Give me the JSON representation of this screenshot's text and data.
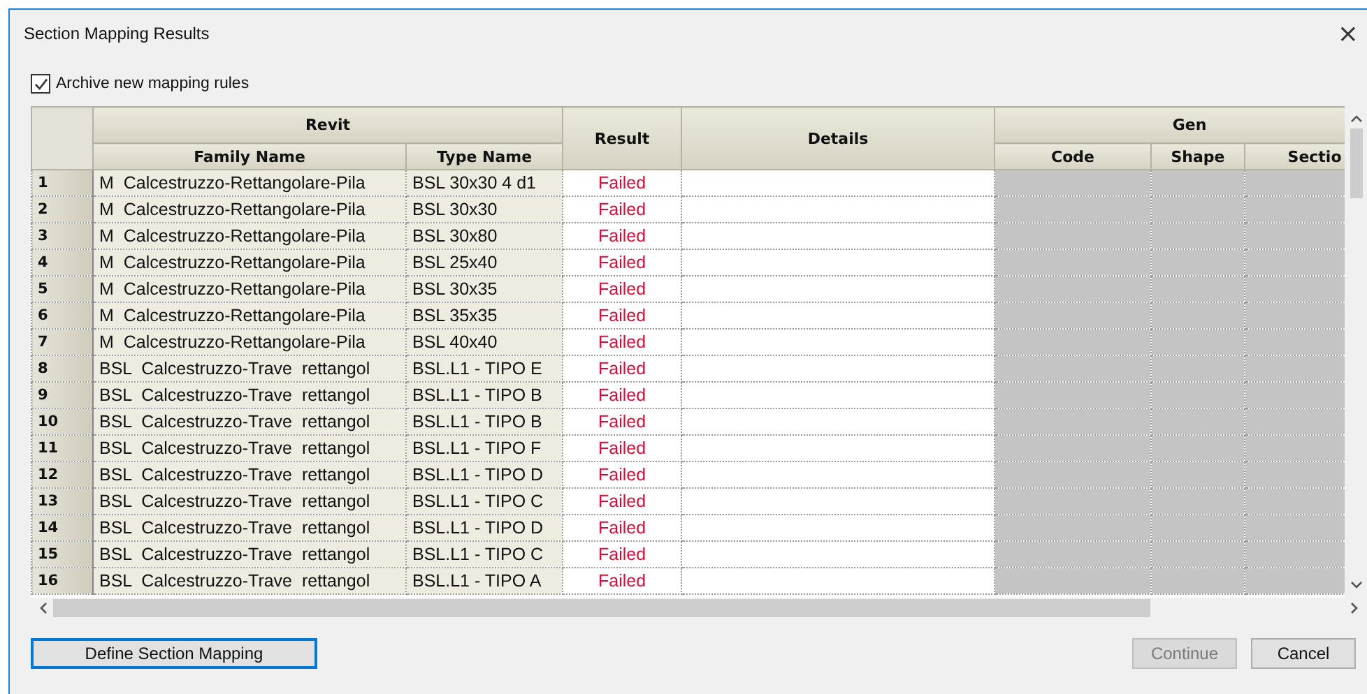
{
  "window": {
    "title": "Section Mapping Results",
    "close": "×"
  },
  "archive_checkbox": {
    "label": "Archive new mapping rules",
    "checked": true
  },
  "table": {
    "groups": [
      {
        "label": "Revit",
        "columns": [
          "Family Name",
          "Type Name"
        ]
      },
      {
        "label": "Result"
      },
      {
        "label": "Details"
      },
      {
        "label": "Gen",
        "columns": [
          "Code",
          "Shape",
          "Sectio"
        ]
      }
    ],
    "rows": [
      {
        "number": "1",
        "family_name": "M  Calcestruzzo-Rettangolare-Pila",
        "type_name": "BSL 30x30 4 d1",
        "result": "Failed"
      },
      {
        "number": "2",
        "family_name": "M  Calcestruzzo-Rettangolare-Pila",
        "type_name": "BSL 30x30",
        "result": "Failed"
      },
      {
        "number": "3",
        "family_name": "M  Calcestruzzo-Rettangolare-Pila",
        "type_name": "BSL 30x80",
        "result": "Failed"
      },
      {
        "number": "4",
        "family_name": "M  Calcestruzzo-Rettangolare-Pila",
        "type_name": "BSL 25x40",
        "result": "Failed"
      },
      {
        "number": "5",
        "family_name": "M  Calcestruzzo-Rettangolare-Pila",
        "type_name": "BSL 30x35",
        "result": "Failed"
      },
      {
        "number": "6",
        "family_name": "M  Calcestruzzo-Rettangolare-Pila",
        "type_name": "BSL 35x35",
        "result": "Failed"
      },
      {
        "number": "7",
        "family_name": "M  Calcestruzzo-Rettangolare-Pila",
        "type_name": "BSL 40x40",
        "result": "Failed"
      },
      {
        "number": "8",
        "family_name": "BSL  Calcestruzzo-Trave  rettangol",
        "type_name": "BSL.L1 - TIPO E",
        "result": "Failed"
      },
      {
        "number": "9",
        "family_name": "BSL  Calcestruzzo-Trave  rettangol",
        "type_name": "BSL.L1 - TIPO B",
        "result": "Failed"
      },
      {
        "number": "10",
        "family_name": "BSL  Calcestruzzo-Trave  rettangol",
        "type_name": "BSL.L1 - TIPO B",
        "result": "Failed"
      },
      {
        "number": "11",
        "family_name": "BSL  Calcestruzzo-Trave  rettangol",
        "type_name": "BSL.L1 - TIPO F",
        "result": "Failed"
      },
      {
        "number": "12",
        "family_name": "BSL  Calcestruzzo-Trave  rettangol",
        "type_name": "BSL.L1 - TIPO D",
        "result": "Failed"
      },
      {
        "number": "13",
        "family_name": "BSL  Calcestruzzo-Trave  rettangol",
        "type_name": "BSL.L1 - TIPO C",
        "result": "Failed"
      },
      {
        "number": "14",
        "family_name": "BSL  Calcestruzzo-Trave  rettangol",
        "type_name": "BSL.L1 - TIPO D",
        "result": "Failed"
      },
      {
        "number": "15",
        "family_name": "BSL  Calcestruzzo-Trave  rettangol",
        "type_name": "BSL.L1 - TIPO C",
        "result": "Failed"
      },
      {
        "number": "16",
        "family_name": "BSL  Calcestruzzo-Trave  rettangol",
        "type_name": "BSL.L1 - TIPO A",
        "result": "Failed"
      }
    ]
  },
  "buttons": [
    {
      "label": "Define Section Mapping",
      "disabled": false,
      "focused": true
    },
    {
      "label": "Continue",
      "disabled": true,
      "focused": false
    },
    {
      "label": "Cancel",
      "disabled": false,
      "focused": false
    }
  ]
}
